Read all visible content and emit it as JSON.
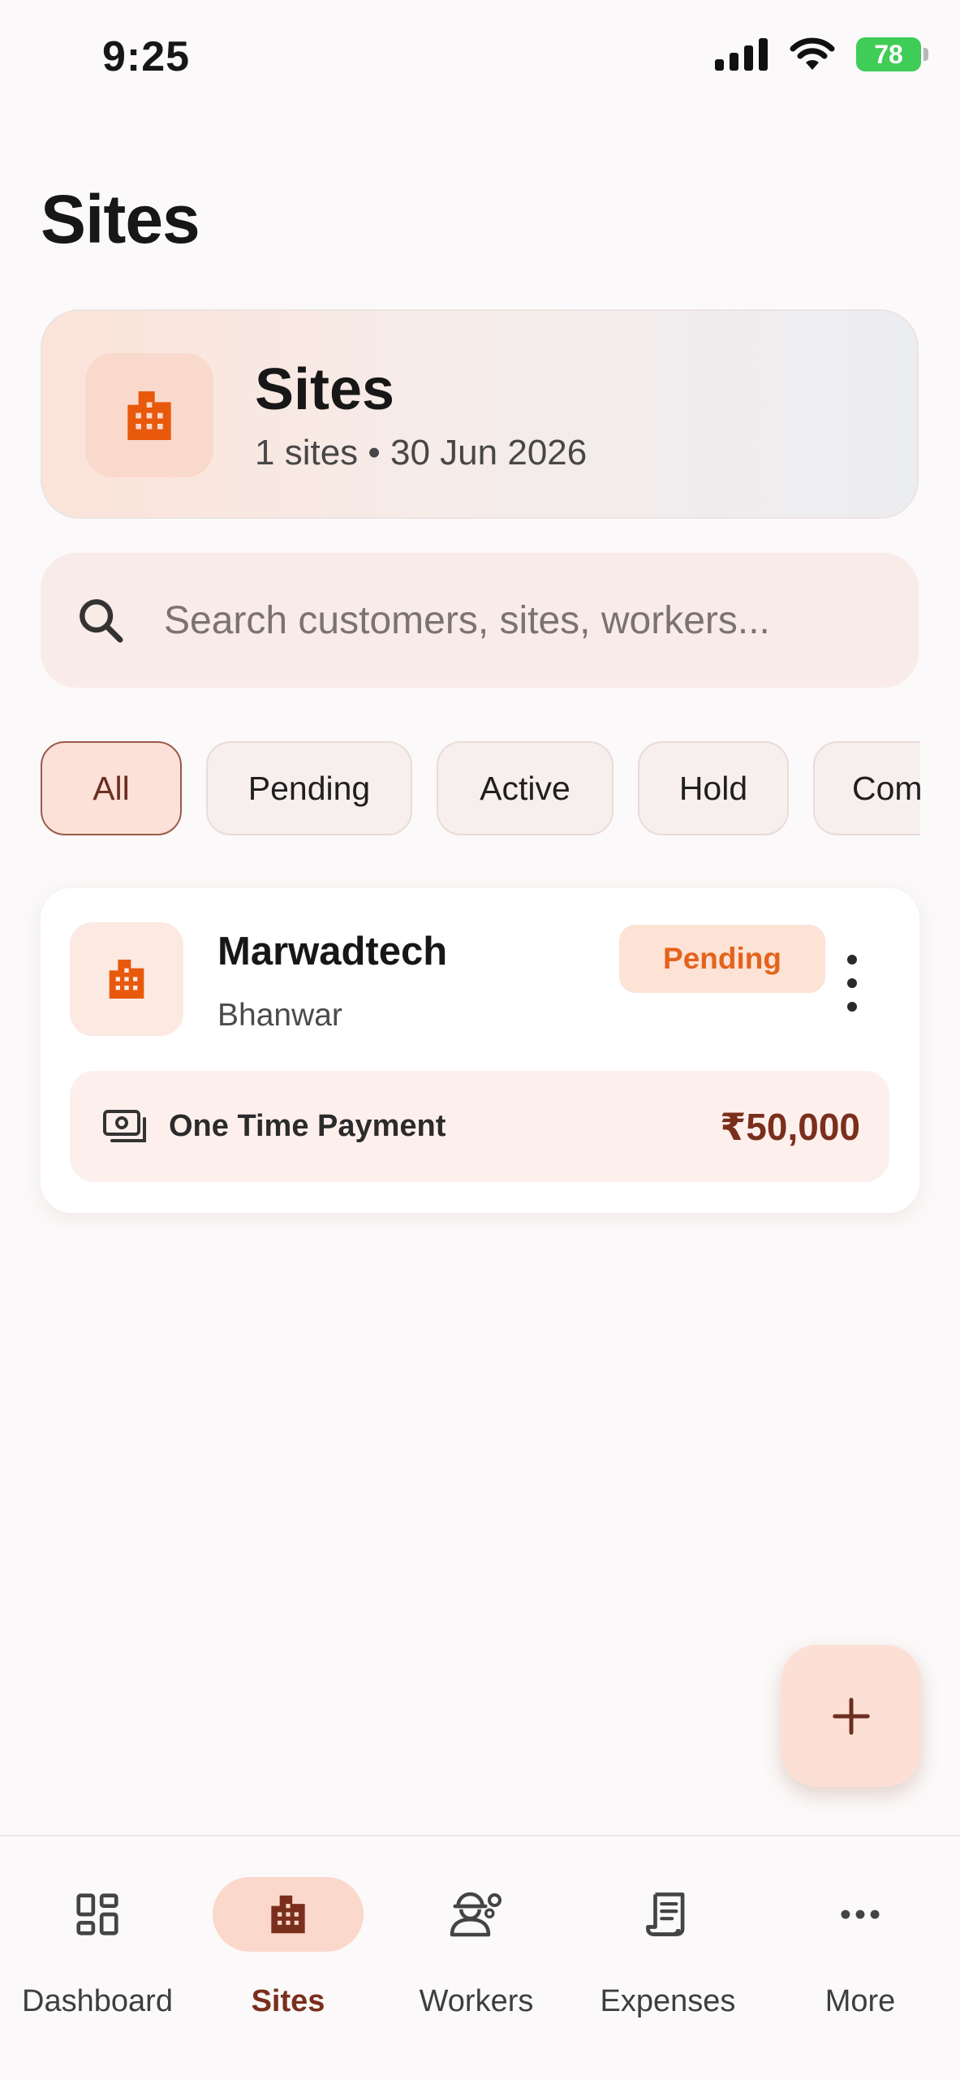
{
  "status_bar": {
    "time": "9:25",
    "battery": "78"
  },
  "page": {
    "title": "Sites"
  },
  "header_card": {
    "title": "Sites",
    "subtitle": "1 sites • 30 Jun 2026"
  },
  "search": {
    "placeholder": "Search customers, sites, workers..."
  },
  "filters": [
    {
      "label": "All",
      "active": true
    },
    {
      "label": "Pending",
      "active": false
    },
    {
      "label": "Active",
      "active": false
    },
    {
      "label": "Hold",
      "active": false
    },
    {
      "label": "Completed",
      "active": false
    }
  ],
  "sites": [
    {
      "name": "Marwadtech",
      "location": "Bhanwar",
      "status": "Pending",
      "payment_type": "One Time Payment",
      "amount": "₹50,000"
    }
  ],
  "bottom_nav": [
    {
      "label": "Dashboard",
      "icon": "dashboard-icon",
      "active": false
    },
    {
      "label": "Sites",
      "icon": "building-icon",
      "active": true
    },
    {
      "label": "Workers",
      "icon": "worker-icon",
      "active": false
    },
    {
      "label": "Expenses",
      "icon": "receipt-icon",
      "active": false
    },
    {
      "label": "More",
      "icon": "more-horizontal-icon",
      "active": false
    }
  ],
  "colors": {
    "accent": "#e4631c",
    "accent_dark": "#7a2f1c",
    "accent_light": "#fce0d6",
    "battery": "#3fcc57"
  }
}
